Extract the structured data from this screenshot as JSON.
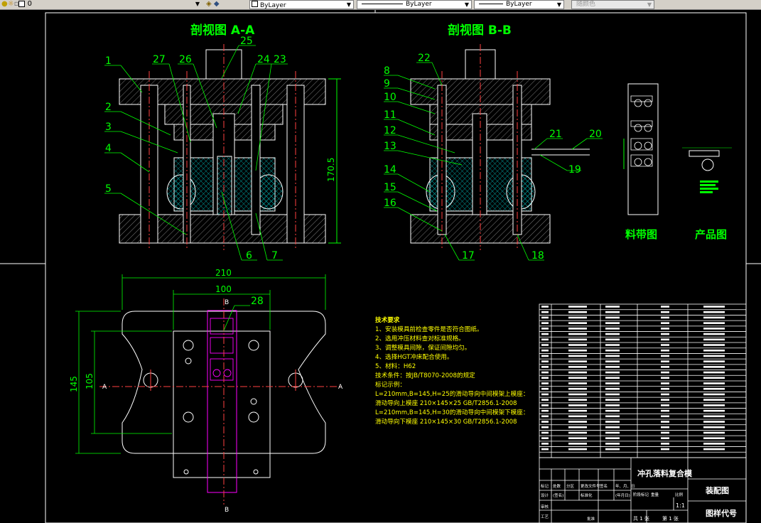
{
  "toolbar": {
    "layer_name": "0",
    "color_combo": "ByLayer",
    "linetype_combo": "ByLayer",
    "lineweight_combo": "ByLayer",
    "plotstyle_combo": "随颜色"
  },
  "drawing": {
    "section_aa_title": "剖视图 A-A",
    "section_bb_title": "剖视图 B-B",
    "dim_overall_height": "170.5",
    "dim_width_210": "210",
    "dim_width_100": "100",
    "dim_height_145": "145",
    "dim_height_105": "105",
    "section_marker_a": "A",
    "section_marker_b": "B",
    "strip_label": "料带图",
    "product_label": "产品图",
    "balloons_left": [
      "1",
      "2",
      "3",
      "4",
      "5",
      "27",
      "26",
      "25",
      "24",
      "23",
      "6",
      "7"
    ],
    "balloons_right": [
      "8",
      "9",
      "10",
      "11",
      "12",
      "13",
      "14",
      "15",
      "16",
      "22",
      "21",
      "20",
      "19",
      "17",
      "18"
    ],
    "balloon_28": "28"
  },
  "tech_notes": {
    "heading": "技术要求",
    "lines": [
      "1、安装模具前检查零件是否符合图纸。",
      "2、选用冲压材料查对标准规格。",
      "3、调整模具间隙，保证间隙均匀。",
      "4、选择HGT冲床配合使用。",
      "5、材料：H62",
      "   技术条件：按JB/T8070-2008的规定",
      "   标记示例：",
      "   L=210mm,B=145,H=25的滑动导向中间模架上模座：",
      "   滑动导向上模座  210×145×25  GB/T2856.1-2008",
      "   L=210mm,B=145,H=30的滑动导向中间模架下模座：",
      "   滑动导向下模座  210×145×30  GB/T2856.1-2008"
    ]
  },
  "title_block": {
    "drawing_name": "冲孔落料复合模",
    "drawing_type": "装配图",
    "drawing_code": "图样代号",
    "scale": "1:1",
    "sheet_total": "共 1 张",
    "sheet_no": "第 1 张",
    "row_labels": [
      "标记",
      "处数",
      "分区",
      "更改文件号",
      "签名",
      "年、月、日",
      "设计",
      "(签名)",
      "(年月日)",
      "标准化",
      "审核",
      "工艺",
      "批准",
      "阶段标记",
      "重量",
      "比例"
    ]
  },
  "colors": {
    "background": "#000000",
    "outline": "#ffffff",
    "dimension": "#00ff00",
    "centerline": "#ff0000",
    "hatch": "#00ffff",
    "strip_outline": "#ff00ff",
    "tech_text": "#ffff00",
    "toolbar_bg": "#d4d0c8"
  }
}
